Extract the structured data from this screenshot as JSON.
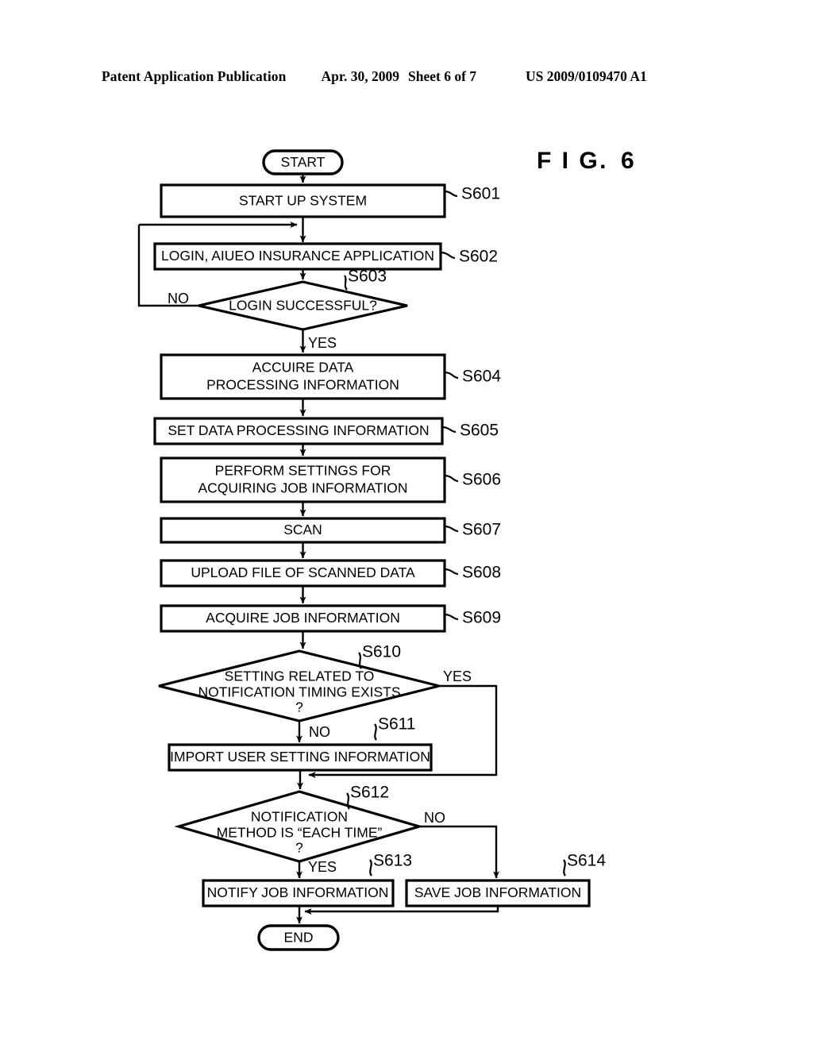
{
  "header": {
    "publication_title": "Patent Application Publication",
    "date": "Apr. 30, 2009",
    "sheet": "Sheet 6 of 7",
    "publication_number": "US 2009/0109470 A1"
  },
  "figure": {
    "label": "F I G.",
    "number": "6"
  },
  "flowchart": {
    "terminals": {
      "start": "START",
      "end": "END"
    },
    "nodes": [
      {
        "id": "S601",
        "type": "process",
        "ref": "S601",
        "lines": [
          "START UP SYSTEM"
        ]
      },
      {
        "id": "S602",
        "type": "process",
        "ref": "S602",
        "lines": [
          "LOGIN, AIUEO INSURANCE APPLICATION"
        ]
      },
      {
        "id": "S603",
        "type": "decision",
        "ref": "S603",
        "lines": [
          "LOGIN SUCCESSFUL?"
        ]
      },
      {
        "id": "S604",
        "type": "process",
        "ref": "S604",
        "lines": [
          "ACCUIRE DATA",
          "PROCESSING INFORMATION"
        ]
      },
      {
        "id": "S605",
        "type": "process",
        "ref": "S605",
        "lines": [
          "SET DATA PROCESSING INFORMATION"
        ]
      },
      {
        "id": "S606",
        "type": "process",
        "ref": "S606",
        "lines": [
          "PERFORM SETTINGS FOR",
          "ACQUIRING JOB INFORMATION"
        ]
      },
      {
        "id": "S607",
        "type": "process",
        "ref": "S607",
        "lines": [
          "SCAN"
        ]
      },
      {
        "id": "S608",
        "type": "process",
        "ref": "S608",
        "lines": [
          "UPLOAD FILE OF SCANNED DATA"
        ]
      },
      {
        "id": "S609",
        "type": "process",
        "ref": "S609",
        "lines": [
          "ACQUIRE JOB INFORMATION"
        ]
      },
      {
        "id": "S610",
        "type": "decision",
        "ref": "S610",
        "lines": [
          "SETTING RELATED TO",
          "NOTIFICATION TIMING EXISTS",
          "?"
        ]
      },
      {
        "id": "S611",
        "type": "process",
        "ref": "S611",
        "lines": [
          "IMPORT USER SETTING INFORMATION"
        ]
      },
      {
        "id": "S612",
        "type": "decision",
        "ref": "S612",
        "lines": [
          "NOTIFICATION",
          "METHOD IS “EACH TIME”",
          "?"
        ]
      },
      {
        "id": "S613",
        "type": "process",
        "ref": "S613",
        "lines": [
          "NOTIFY JOB INFORMATION"
        ]
      },
      {
        "id": "S614",
        "type": "process",
        "ref": "S614",
        "lines": [
          "SAVE JOB INFORMATION"
        ]
      }
    ],
    "branch_labels": {
      "s603_no": "NO",
      "s603_yes": "YES",
      "s610_yes": "YES",
      "s610_no": "NO",
      "s612_no": "NO",
      "s612_yes": "YES"
    }
  },
  "colors": {
    "ink": "#000000",
    "paper": "#ffffff"
  }
}
